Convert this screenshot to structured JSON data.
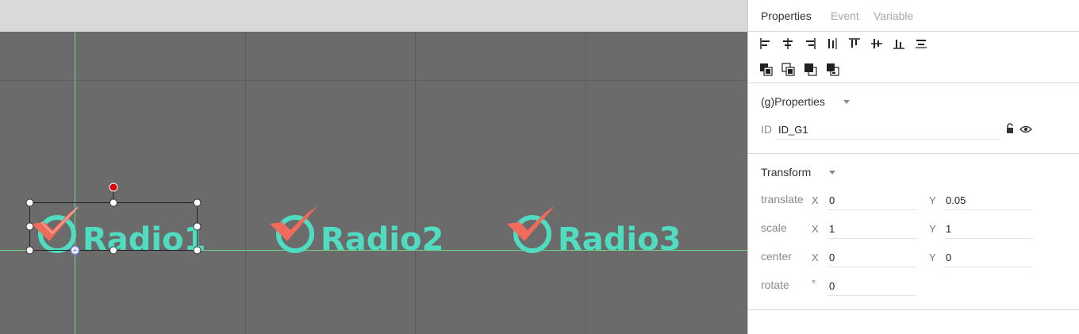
{
  "tabs": [
    {
      "label": "Properties",
      "active": true
    },
    {
      "label": "Event",
      "active": false
    },
    {
      "label": "Variable",
      "active": false
    }
  ],
  "toolbar": {
    "align_tools": [
      "align-left-icon",
      "align-center-h-icon",
      "align-right-icon",
      "distribute-h-icon",
      "align-top-icon",
      "align-middle-v-icon",
      "align-bottom-icon",
      "distribute-v-icon"
    ],
    "layer_tools": [
      "bring-to-front-icon",
      "bring-forward-icon",
      "send-backward-icon",
      "send-to-back-icon"
    ]
  },
  "group_properties": {
    "title": "(g)Properties",
    "id_label": "ID",
    "id_value": "ID_G1"
  },
  "transform": {
    "title": "Transform",
    "translate": {
      "label": "translate",
      "x_label": "X",
      "x": "0",
      "y_label": "Y",
      "y": "0.05"
    },
    "scale": {
      "label": "scale",
      "x_label": "X",
      "x": "1",
      "y_label": "Y",
      "y": "1"
    },
    "center": {
      "label": "center",
      "x_label": "X",
      "x": "0",
      "y_label": "Y",
      "y": "0"
    },
    "rotate": {
      "label": "rotate",
      "unit": "°",
      "value": "0"
    }
  },
  "canvas": {
    "radios": [
      "Radio1",
      "Radio2",
      "Radio3"
    ],
    "colors": {
      "background": "#6b6b6b",
      "grid": "#5e5e5e",
      "guide": "#6fd58a",
      "text": "#4fdcc0",
      "check": "#ef6b5b",
      "handle_rotate": "#e00000"
    }
  }
}
